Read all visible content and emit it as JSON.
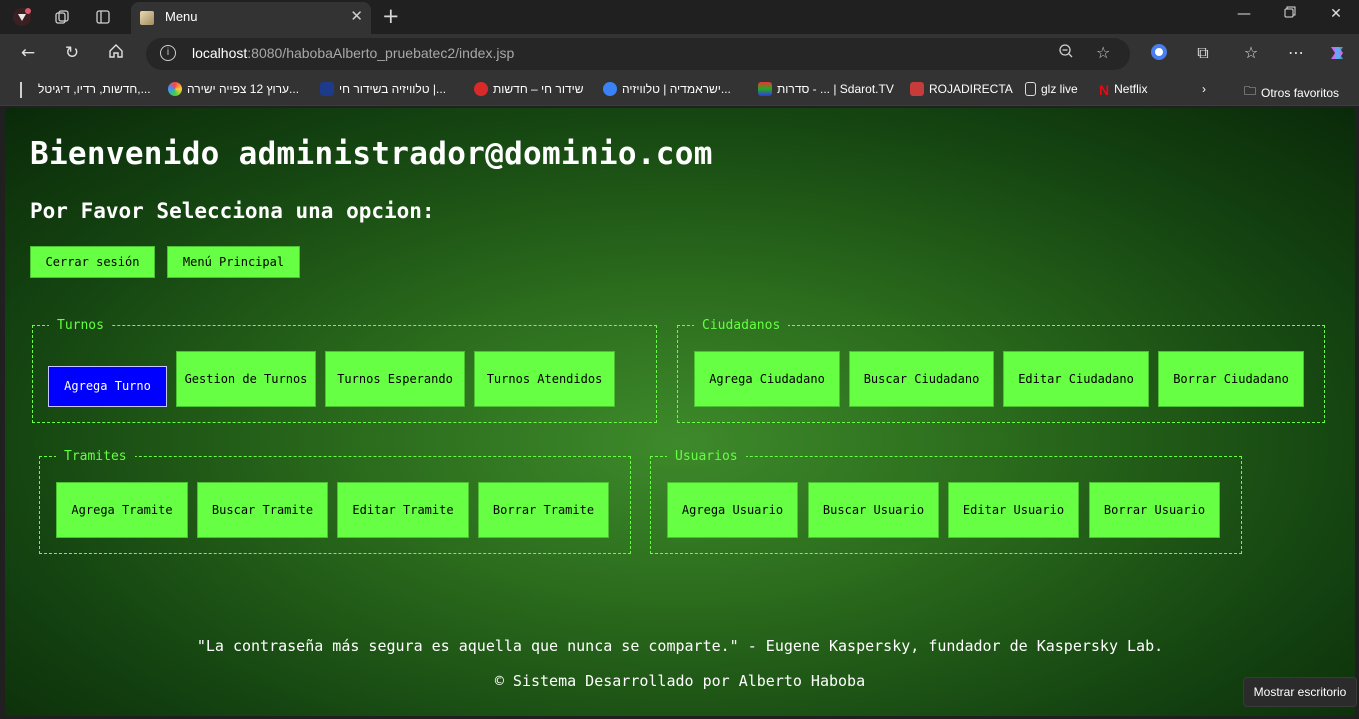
{
  "browser": {
    "tab_title": "Menu",
    "url_host": "localhost",
    "url_rest": ":8080/habobaAlberto_pruebatec2/index.jsp",
    "bookmarks": [
      "חדשות, רדיו, דיגיטל,...",
      "ערוץ 12 צפייה ישירה...",
      "טלוויזיה בשידור חי |...",
      "שידור חי – חדשות",
      "ישראמדיה | טלוויזיה...",
      "סדרות - ... | Sdarot.TV",
      "ROJADIRECTA",
      "glz live",
      "Netflix"
    ],
    "other_favorites": "Otros favoritos"
  },
  "page": {
    "welcome": "Bienvenido administrador@dominio.com",
    "subtitle": "Por Favor Selecciona una opcion:",
    "logout_label": "Cerrar sesión",
    "main_menu_label": "Menú Principal",
    "groups": {
      "turnos": {
        "legend": "Turnos",
        "buttons": [
          "Agrega Turno",
          "Gestion de Turnos",
          "Turnos Esperando",
          "Turnos Atendidos"
        ]
      },
      "ciudadanos": {
        "legend": "Ciudadanos",
        "buttons": [
          "Agrega Ciudadano",
          "Buscar Ciudadano",
          "Editar Ciudadano",
          "Borrar Ciudadano"
        ]
      },
      "tramites": {
        "legend": "Tramites",
        "buttons": [
          "Agrega Tramite",
          "Buscar Tramite",
          "Editar Tramite",
          "Borrar Tramite"
        ]
      },
      "usuarios": {
        "legend": "Usuarios",
        "buttons": [
          "Agrega Usuario",
          "Buscar Usuario",
          "Editar Usuario",
          "Borrar Usuario"
        ]
      }
    },
    "quote": "\"La contraseña más segura es aquella que nunca se comparte.\" - Eugene Kaspersky, fundador de Kaspersky Lab.",
    "footer": "© Sistema Desarrollado por Alberto Haboba"
  },
  "taskbar_tip": "Mostrar escritorio",
  "colors": {
    "button_green": "#66ff44",
    "active_blue": "#0000ff",
    "legend_green": "#66ff44"
  }
}
